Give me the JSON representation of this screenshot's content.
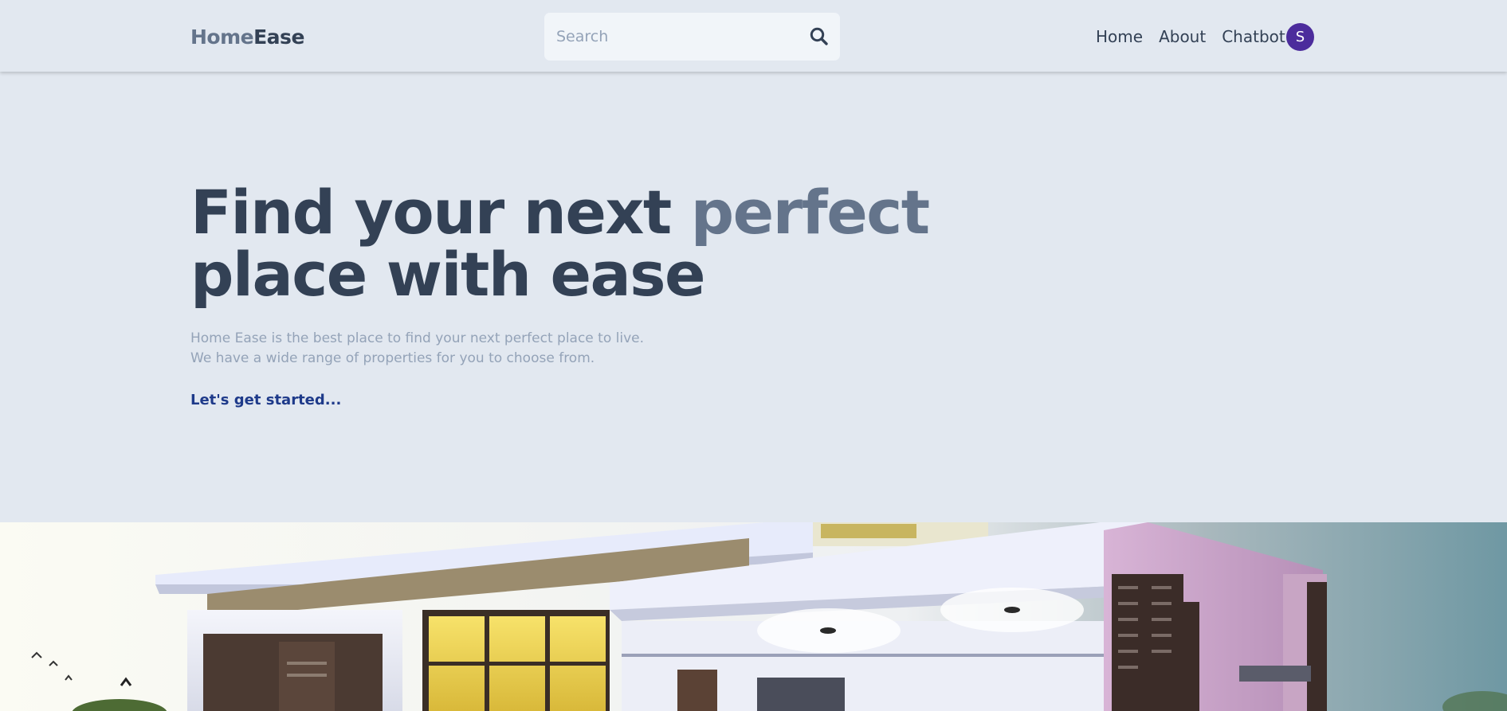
{
  "brand": {
    "part1": "Home",
    "part2": "Ease"
  },
  "search": {
    "placeholder": "Search",
    "icon": "search-icon"
  },
  "nav": {
    "links": [
      "Home",
      "About",
      "Chatbot"
    ],
    "avatar_initial": "S"
  },
  "hero": {
    "title_part1": "Find your next ",
    "title_accent": "perfect",
    "title_line2": "place with ease",
    "subtitle_line1": "Home Ease is the best place to find your next perfect place to live.",
    "subtitle_line2": "We have a wide range of properties for you to choose from.",
    "cta": "Let's get started..."
  },
  "colors": {
    "background": "#e2e8f0",
    "heading": "#334155",
    "accent": "#64748b",
    "muted": "#94a3b8",
    "link": "#1e3a8a",
    "avatar": "#4c2c9c"
  }
}
